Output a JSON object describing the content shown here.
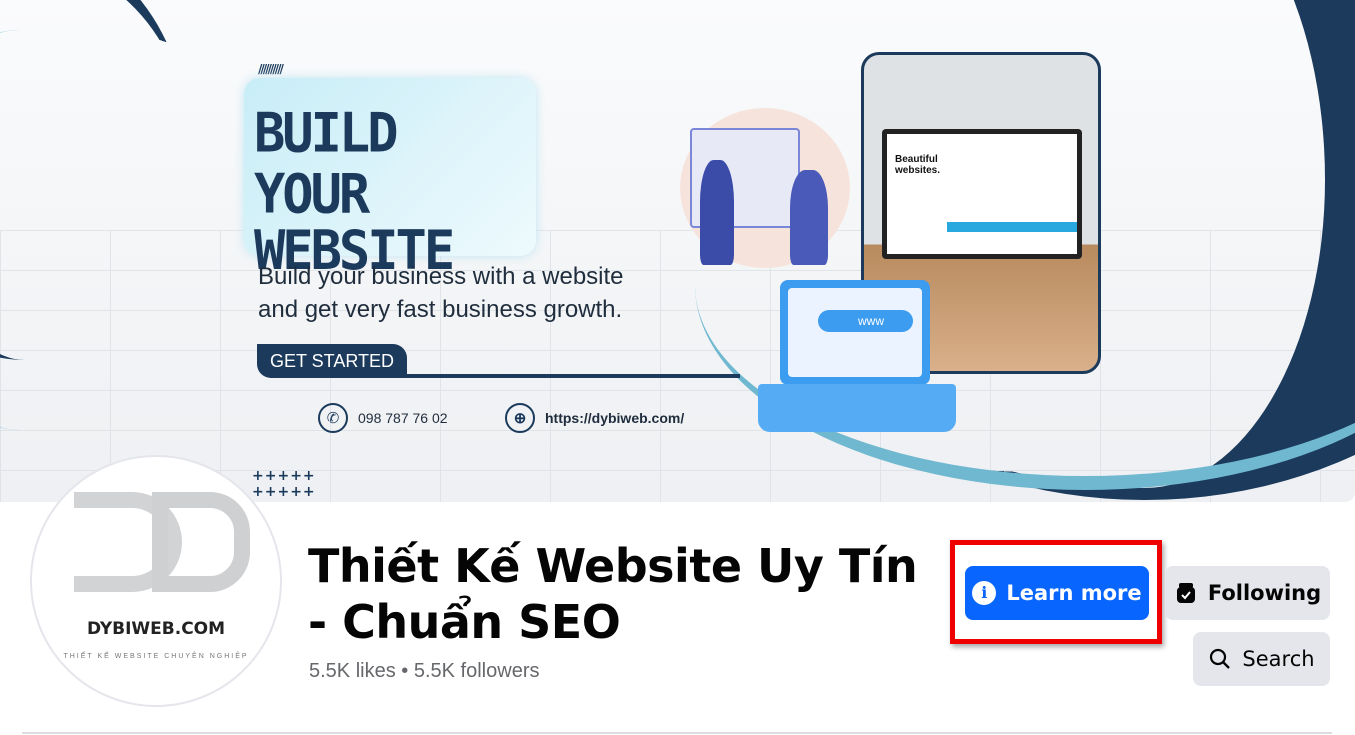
{
  "cover": {
    "headline_line1": "BUILD YOUR",
    "headline_line2": "WEBSITE",
    "subtext_line1": "Build your business with a website",
    "subtext_line2": "and get very fast business growth.",
    "cta": "GET STARTED",
    "phone": "098 787 76 02",
    "website": "https://dybiweb.com/",
    "monitor_text": "Beautiful websites.",
    "laptop_text": "www"
  },
  "profile": {
    "logo_name": "DYBIWEB.COM",
    "logo_tagline": "THIẾT KẾ WEBSITE CHUYÊN NGHIỆP"
  },
  "page": {
    "title": "Thiết Kế Website Uy Tín - Chuẩn SEO",
    "likes": "5.5K likes",
    "separator": "•",
    "followers": "5.5K followers"
  },
  "actions": {
    "learn_more": "Learn more",
    "following": "Following",
    "search": "Search"
  },
  "colors": {
    "primary": "#0866ff",
    "highlight": "#e00000",
    "navy": "#1b3a5c"
  }
}
